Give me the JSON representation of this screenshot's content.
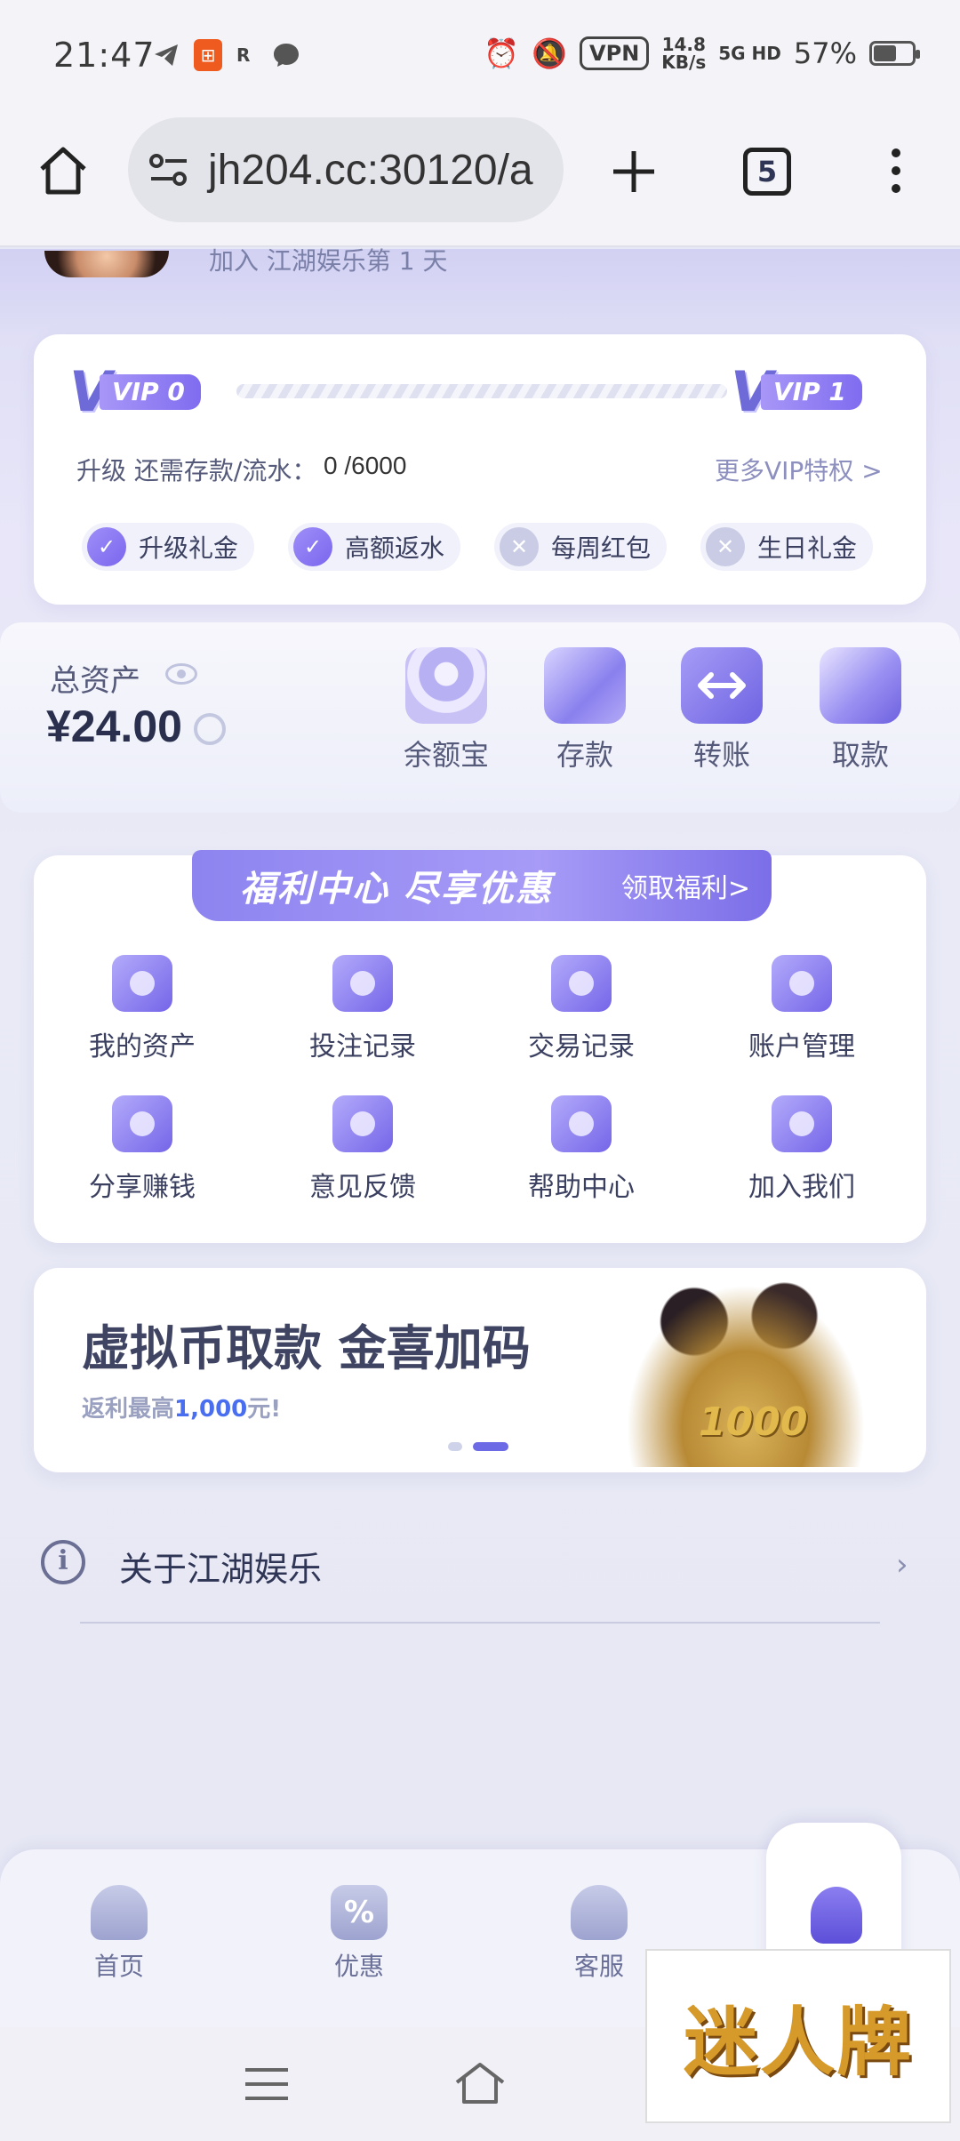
{
  "status_bar": {
    "time": "21:47",
    "vpn": "VPN",
    "speed_value": "14.8",
    "speed_unit": "KB/s",
    "network": "5G HD",
    "battery": "57%"
  },
  "browser": {
    "url": "jh204.cc:30120/a",
    "tab_count": "5"
  },
  "profile": {
    "join_text": "加入 江湖娱乐第 1 天"
  },
  "vip": {
    "current": "VIP 0",
    "next": "VIP 1",
    "upgrade_label": "升级 还需存款/流水：",
    "upgrade_value": "0 /6000",
    "more_link": "更多VIP特权 >",
    "perks": [
      {
        "label": "升级礼金",
        "enabled": true
      },
      {
        "label": "高额返水",
        "enabled": true
      },
      {
        "label": "每周红包",
        "enabled": false
      },
      {
        "label": "生日礼金",
        "enabled": false
      }
    ]
  },
  "assets": {
    "label": "总资产",
    "value": "¥24.00",
    "actions": [
      {
        "label": "余额宝",
        "icon": "yuebao-icon"
      },
      {
        "label": "存款",
        "icon": "wallet-icon"
      },
      {
        "label": "转账",
        "icon": "transfer-icon"
      },
      {
        "label": "取款",
        "icon": "card-icon"
      }
    ]
  },
  "welfare": {
    "title": "福利中心 尽享优惠",
    "button": "领取福利>",
    "items": [
      {
        "label": "我的资产",
        "icon": "wallet-icon"
      },
      {
        "label": "投注记录",
        "icon": "clock-icon"
      },
      {
        "label": "交易记录",
        "icon": "exchange-icon"
      },
      {
        "label": "账户管理",
        "icon": "folder-user-icon"
      },
      {
        "label": "分享赚钱",
        "icon": "yen-share-icon"
      },
      {
        "label": "意见反馈",
        "icon": "mail-icon"
      },
      {
        "label": "帮助中心",
        "icon": "question-icon"
      },
      {
        "label": "加入我们",
        "icon": "add-user-icon"
      }
    ]
  },
  "promo": {
    "title": "虚拟币取款 金喜加码",
    "subtitle_prefix": "返利最高",
    "subtitle_highlight": "1,000",
    "subtitle_suffix": "元!",
    "badge": "1000"
  },
  "about": {
    "label": "关于江湖娱乐"
  },
  "bottom_nav": [
    {
      "label": "首页",
      "icon": "home-icon"
    },
    {
      "label": "优惠",
      "icon": "discount-icon"
    },
    {
      "label": "客服",
      "icon": "headset-icon"
    },
    {
      "label": "",
      "icon": "profile-icon"
    }
  ],
  "watermark": "迷人牌"
}
